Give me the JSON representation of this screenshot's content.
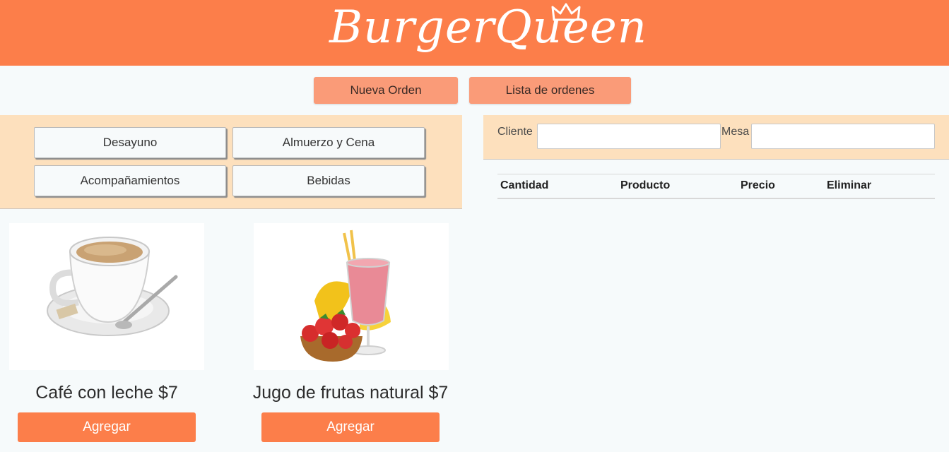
{
  "header": {
    "brand_text": "BurgerQueen",
    "brand_color": "#fc7e4a"
  },
  "nav": {
    "new_order": "Nueva Orden",
    "order_list": "Lista de ordenes"
  },
  "categories": [
    {
      "label": "Desayuno"
    },
    {
      "label": "Almuerzo y Cena"
    },
    {
      "label": "Acompañamientos"
    },
    {
      "label": "Bebidas"
    }
  ],
  "products": [
    {
      "name": "Café con leche $7",
      "add_label": "Agregar",
      "image_icon": "coffee-cup-icon"
    },
    {
      "name": "Jugo de frutas natural $7",
      "add_label": "Agregar",
      "image_icon": "fruit-smoothie-icon"
    }
  ],
  "order": {
    "client_label": "Cliente",
    "client_value": "",
    "table_label": "Mesa",
    "table_value": "",
    "columns": [
      "Cantidad",
      "Producto",
      "Precio",
      "Eliminar"
    ]
  }
}
